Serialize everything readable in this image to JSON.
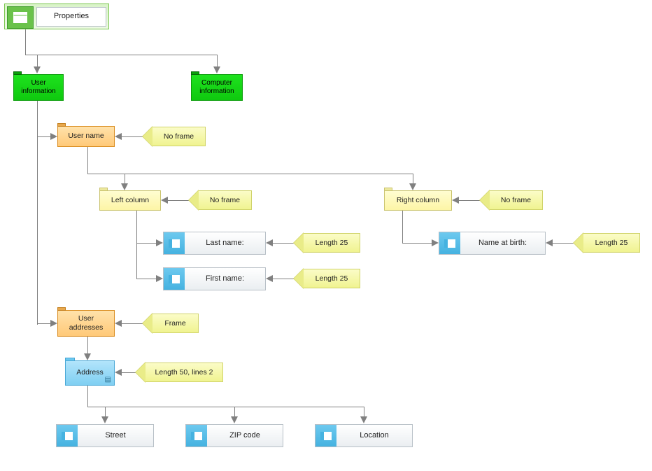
{
  "root": {
    "label": "Properties"
  },
  "categories": {
    "user_info": "User\ninformation",
    "computer_info": "Computer\ninformation"
  },
  "containers": {
    "user_name": "User name",
    "user_addresses": "User\naddresses"
  },
  "columns": {
    "left": "Left column",
    "right": "Right column"
  },
  "fields": {
    "last_name": "Last name:",
    "first_name": "First name:",
    "name_at_birth": "Name at birth:",
    "street": "Street",
    "zip_code": "ZIP code",
    "location": "Location"
  },
  "address_tile": "Address",
  "notes": {
    "no_frame": "No frame",
    "frame": "Frame",
    "length_25": "Length 25",
    "length_50_lines_2": "Length 50, lines 2"
  }
}
